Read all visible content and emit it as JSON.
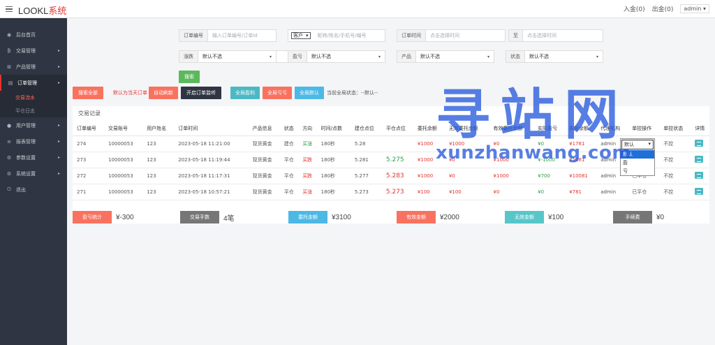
{
  "header": {
    "logo_main": "LOOKL",
    "logo_accent": "系统",
    "deposit": "入金(0)",
    "withdraw": "出金(0)",
    "admin": "admin"
  },
  "sidebar": {
    "items": [
      {
        "label": "后台首页",
        "icon": "dashboard-icon",
        "glyph": "◉",
        "arrow": ""
      },
      {
        "label": "交易管理",
        "icon": "bitcoin-icon",
        "glyph": "₿",
        "arrow": "▸"
      },
      {
        "label": "产品管理",
        "icon": "cart-icon",
        "glyph": "⊞",
        "arrow": "▸"
      },
      {
        "label": "订单管理",
        "icon": "order-icon",
        "glyph": "▤",
        "arrow": "▸"
      },
      {
        "label": "用户管理",
        "icon": "user-icon",
        "glyph": "●",
        "arrow": "▸"
      },
      {
        "label": "报表管理",
        "icon": "report-icon",
        "glyph": "≡",
        "arrow": "▸"
      },
      {
        "label": "参数设置",
        "icon": "settings-icon",
        "glyph": "⚙",
        "arrow": "▸"
      },
      {
        "label": "系统设置",
        "icon": "system-icon",
        "glyph": "⚙",
        "arrow": "▸"
      },
      {
        "label": "退出",
        "icon": "logout-icon",
        "glyph": "⏻",
        "arrow": ""
      }
    ],
    "sub": [
      "交易流水",
      "平仓日志"
    ]
  },
  "filters": {
    "order_no": {
      "label": "订单编号",
      "placeholder": "输入订单编号/订单id"
    },
    "customer": {
      "select": "客户",
      "placeholder": "昵称/姓名/手机号/编号"
    },
    "order_time": {
      "label": "订单时间",
      "placeholder": "点击选择时间"
    },
    "to": {
      "label": "至",
      "placeholder": "点击选择时间"
    },
    "rise_fall": {
      "label": "涨跌",
      "value": "默认不选"
    },
    "profit_loss": {
      "label": "盈亏",
      "value": "默认不选"
    },
    "product": {
      "label": "产品",
      "value": "默认不选"
    },
    "status": {
      "label": "状态",
      "value": "默认不选"
    },
    "search": "搜索"
  },
  "actions": {
    "search_all": "搜索全部",
    "default_today": "默认为当天订单",
    "auto_refresh": "自动刷新",
    "listen": "开启订单监听",
    "all_gain": "全局盈利",
    "all_loss": "全局亏亏",
    "all_default": "全局默认",
    "global_state": "当前全局状态：--默认--"
  },
  "table": {
    "title": "交易记录",
    "headers": [
      "订单编号",
      "交易账号",
      "用户姓名",
      "订单时间",
      "产品信息",
      "状态",
      "方向",
      "时间/点数",
      "建仓点位",
      "平仓点位",
      "委托余额",
      "无效委托余额",
      "有效委托余额",
      "实际盈亏",
      "实际余额",
      "代理机构",
      "单控操作",
      "单控状态",
      "详情"
    ],
    "rows": [
      {
        "id": "274",
        "account": "10000053",
        "name": "123",
        "time": "2023-05-18 11:21:00",
        "product": "现货黄金",
        "status": "建仓",
        "dir": "买涨",
        "dir_color": "green",
        "dur": "180秒",
        "open": "5.28",
        "close": "",
        "close_color": "",
        "entrust": "¥1000",
        "invalid": "¥1000",
        "valid": "¥0",
        "pl": "¥0",
        "pl_color": "green",
        "balance": "¥1781",
        "bal_color": "red",
        "agent": "admin",
        "op": "默认",
        "ctl": "不控"
      },
      {
        "id": "273",
        "account": "10000053",
        "name": "123",
        "time": "2023-05-18 11:19:44",
        "product": "现货黄金",
        "status": "平仓",
        "dir": "买跌",
        "dir_color": "red",
        "dur": "180秒",
        "open": "5.281",
        "close": "5.275",
        "close_color": "green",
        "entrust": "¥1000",
        "invalid": "¥0",
        "valid": "¥1000",
        "pl": "¥-1000",
        "pl_color": "green",
        "balance": "¥1081",
        "bal_color": "red",
        "agent": "admin",
        "op": "已平仓",
        "ctl": "不控"
      },
      {
        "id": "272",
        "account": "10000053",
        "name": "123",
        "time": "2023-05-18 11:17:31",
        "product": "现货黄金",
        "status": "平仓",
        "dir": "买跌",
        "dir_color": "red",
        "dur": "180秒",
        "open": "5.277",
        "close": "5.283",
        "close_color": "red",
        "entrust": "¥1000",
        "invalid": "¥0",
        "valid": "¥1000",
        "pl": "¥700",
        "pl_color": "green",
        "balance": "¥10081",
        "bal_color": "red",
        "agent": "admin",
        "op": "已平仓",
        "ctl": "不控"
      },
      {
        "id": "271",
        "account": "10000053",
        "name": "123",
        "time": "2023-05-18 10:57:21",
        "product": "现货黄金",
        "status": "平仓",
        "dir": "买涨",
        "dir_color": "red",
        "dur": "180秒",
        "open": "5.273",
        "close": "5.273",
        "close_color": "red",
        "entrust": "¥100",
        "invalid": "¥100",
        "valid": "¥0",
        "pl": "¥0",
        "pl_color": "green",
        "balance": "¥781",
        "bal_color": "red",
        "agent": "admin",
        "op": "已平仓",
        "ctl": "不控"
      }
    ]
  },
  "dropdown": {
    "current": "默认",
    "options": [
      "默认",
      "盈",
      "亏"
    ]
  },
  "stats": [
    {
      "label": "盈亏统计",
      "value": "¥-300",
      "color": "#f8725f"
    },
    {
      "label": "交易手数",
      "value": "4笔",
      "color": "#767676"
    },
    {
      "label": "委托金额",
      "value": "¥3100",
      "color": "#4cb8e6"
    },
    {
      "label": "有效金额",
      "value": "¥2000",
      "color": "#f8725f"
    },
    {
      "label": "无效金额",
      "value": "¥100",
      "color": "#56c6c9"
    },
    {
      "label": "手续费",
      "value": "¥0",
      "color": "#767676"
    }
  ],
  "watermark": {
    "text": "寻站网",
    "url": "xunzhanwang.com"
  },
  "colors": {
    "sidebar": "#2f3542",
    "accent_red": "#f8725f",
    "blue_btn": "#4cb8e6",
    "green_btn": "#5cb85c"
  }
}
